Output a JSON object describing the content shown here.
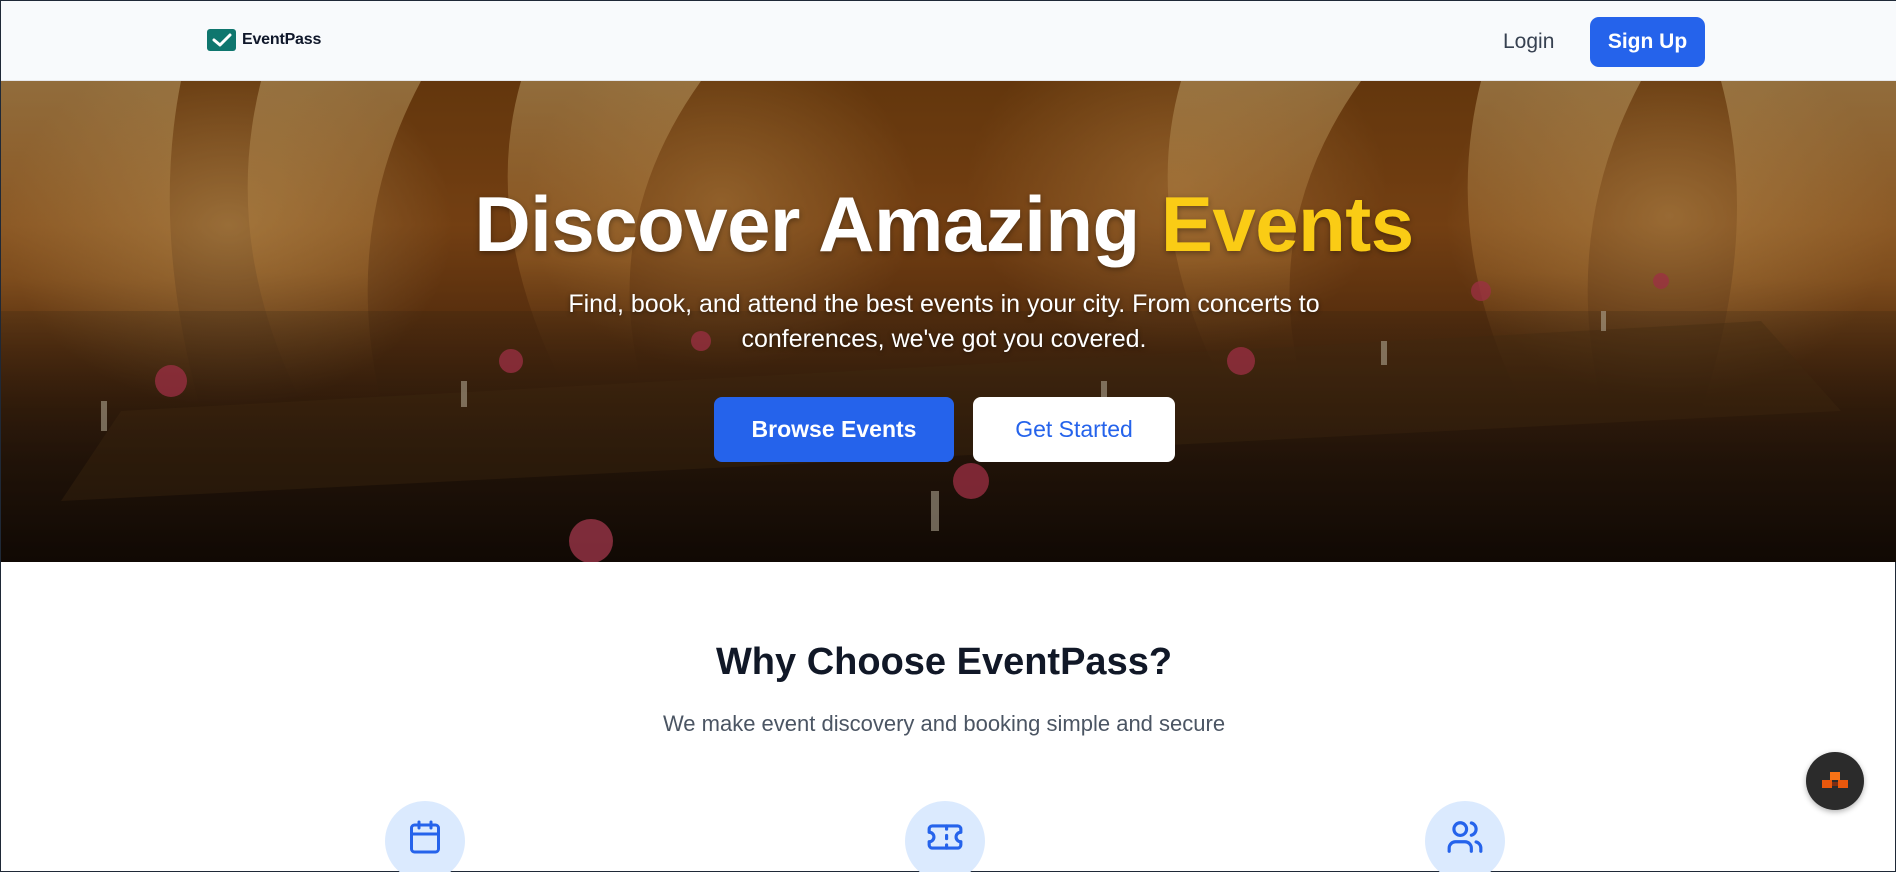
{
  "header": {
    "brand_name": "EventPass",
    "login_label": "Login",
    "signup_label": "Sign Up"
  },
  "hero": {
    "title_main": "Discover Amazing ",
    "title_accent": "Events",
    "subtitle": "Find, book, and attend the best events in your city. From concerts to conferences, we've got you covered.",
    "browse_label": "Browse Events",
    "get_started_label": "Get Started"
  },
  "features": {
    "title": "Why Choose EventPass?",
    "subtitle": "We make event discovery and booking simple and secure",
    "icons": [
      "calendar-icon",
      "ticket-icon",
      "users-icon"
    ]
  },
  "widget": {
    "icon": "assistant-widget-icon"
  },
  "colors": {
    "primary": "#2563eb",
    "accent": "#facc15",
    "brand_green": "#0f766e",
    "feature_icon_bg": "#dbeafe",
    "heading": "#111827"
  }
}
